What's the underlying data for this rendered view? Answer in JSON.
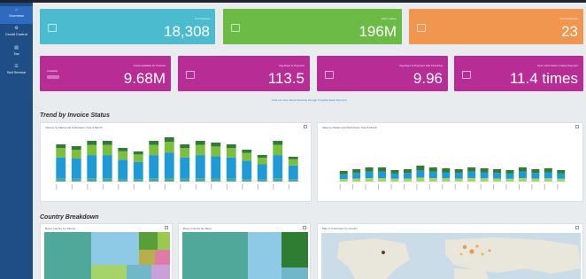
{
  "sidebar": {
    "items": [
      {
        "label": "Overview",
        "icon": "home-icon",
        "active": true
      },
      {
        "label": "Credit Control",
        "icon": "gear-icon",
        "active": false
      },
      {
        "label": "Tax",
        "icon": "receipt-icon",
        "active": false
      },
      {
        "label": "Self Service",
        "icon": "list-icon",
        "active": false
      }
    ]
  },
  "kpis_top": [
    {
      "label": "# of Invoices",
      "value": "18,308",
      "color": "#4bbcd0",
      "icon": "document-icon"
    },
    {
      "label": "Value (value)",
      "value": "196M",
      "color": "#6bbb46",
      "icon": "money-icon"
    },
    {
      "label": "# of Customers",
      "value": "23",
      "color": "#f0964f",
      "icon": "people-icon"
    }
  ],
  "kpis_bottom": [
    {
      "label": "Costs Available for Finance",
      "value": "9.68M",
      "color": "#b82d95",
      "icon": "pill",
      "small": "Available"
    },
    {
      "label": "Avg Days to Payment",
      "value": "113.5",
      "color": "#b82d95",
      "icon": "calendar-icon"
    },
    {
      "label": "Avg Days to Payment with Financing",
      "value": "9.96",
      "color": "#b82d95",
      "icon": "arrow-icon"
    },
    {
      "label": "How much faster is Early Payment",
      "value": "11.4 times",
      "color": "#b82d95",
      "icon": "arrow-icon"
    }
  ],
  "note": "Find out more about financing through Tungsten Early Payment",
  "sections": {
    "trend": "Trend by Invoice Status",
    "country": "Country Breakdown"
  },
  "panels": {
    "volume_title": "Volume by Status and Submission Year & Month",
    "value_title": "Value by Status and Submission Year & Month",
    "buyer_volume_title": "Buyer Country by Volume",
    "buyer_value_title": "Buyer Country by Value",
    "map_title": "Map of Customers by Country"
  },
  "colors": {
    "dark_green": "#2e7d32",
    "green": "#7cbf3f",
    "blue": "#1e9ad6",
    "teal": "#4fa89a",
    "sky": "#8ecae6",
    "light_green": "#a5d46a",
    "olive": "#b7b04a",
    "pink": "#e07aa6",
    "map_sea": "#c9dce8",
    "map_land": "#e9e6dc"
  }
}
